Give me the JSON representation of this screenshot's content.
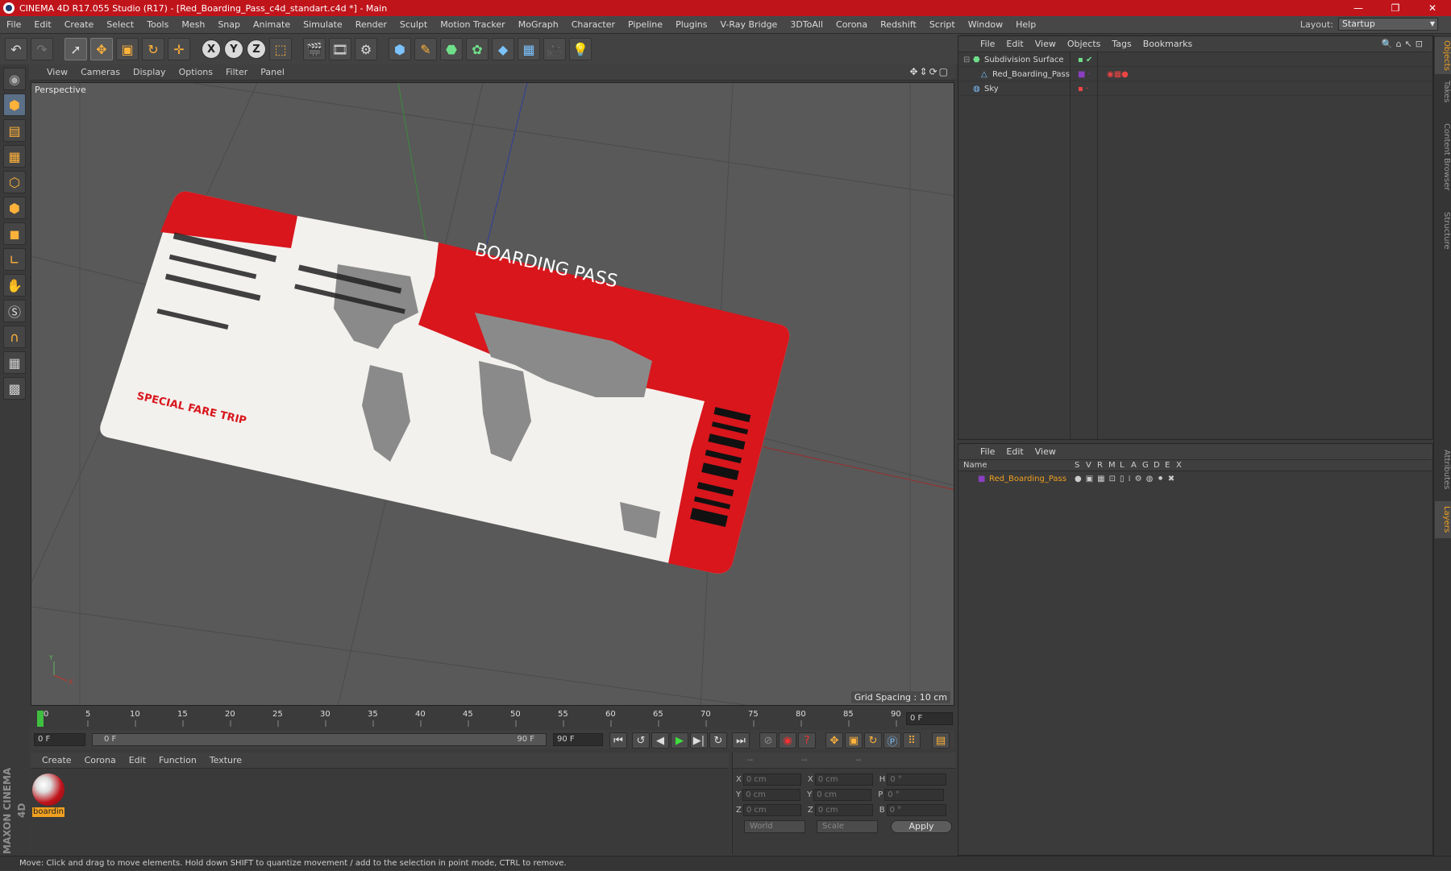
{
  "window": {
    "title": "CINEMA 4D R17.055 Studio (R17) - [Red_Boarding_Pass_c4d_standart.c4d *] - Main",
    "controls": [
      "—",
      "❐",
      "✕"
    ]
  },
  "menu": [
    "File",
    "Edit",
    "Create",
    "Select",
    "Tools",
    "Mesh",
    "Snap",
    "Animate",
    "Simulate",
    "Render",
    "Sculpt",
    "Motion Tracker",
    "MoGraph",
    "Character",
    "Pipeline",
    "Plugins",
    "V-Ray Bridge",
    "3DToAll",
    "Corona",
    "Redshift",
    "Script",
    "Window",
    "Help"
  ],
  "layout": {
    "label": "Layout:",
    "value": "Startup"
  },
  "viewport": {
    "menu": [
      "View",
      "Cameras",
      "Display",
      "Options",
      "Filter",
      "Panel"
    ],
    "label": "Perspective",
    "grid_spacing": "Grid Spacing : 10 cm",
    "axis_x": "X",
    "axis_y": "Y",
    "model_title": "BOARDING PASS",
    "model_tag": "SPECIAL FARE TRIP"
  },
  "timeline": {
    "ticks": [
      "0",
      "5",
      "10",
      "15",
      "20",
      "25",
      "30",
      "35",
      "40",
      "45",
      "50",
      "55",
      "60",
      "65",
      "70",
      "75",
      "80",
      "85",
      "90"
    ],
    "frame_field": "0 F"
  },
  "transport": {
    "start": "0 F",
    "range_start": "0 F",
    "range_end": "90 F",
    "end": "90 F"
  },
  "materials": {
    "menu": [
      "Create",
      "Corona",
      "Edit",
      "Function",
      "Texture"
    ],
    "item": "boardin"
  },
  "coords": {
    "headers": [
      "--",
      "--",
      "--"
    ],
    "rows": [
      {
        "a": "X",
        "av": "0 cm",
        "b": "X",
        "bv": "0 cm",
        "c": "H",
        "cv": "0 °"
      },
      {
        "a": "Y",
        "av": "0 cm",
        "b": "Y",
        "bv": "0 cm",
        "c": "P",
        "cv": "0 °"
      },
      {
        "a": "Z",
        "av": "0 cm",
        "b": "Z",
        "bv": "0 cm",
        "c": "B",
        "cv": "0 °"
      }
    ],
    "mode1": "World",
    "mode2": "Scale",
    "apply": "Apply"
  },
  "objects": {
    "menu": [
      "File",
      "Edit",
      "View",
      "Objects",
      "Tags",
      "Bookmarks"
    ],
    "items": [
      "Subdivision Surface",
      "Red_Boarding_Pass",
      "Sky"
    ]
  },
  "layers": {
    "menu": [
      "File",
      "Edit",
      "View"
    ],
    "columns": [
      "Name",
      "S",
      "V",
      "R",
      "M",
      "L",
      "A",
      "G",
      "D",
      "E",
      "X"
    ],
    "items": [
      "Red_Boarding_Pass"
    ]
  },
  "right_tabs": [
    "Objects",
    "Takes",
    "Content Browser",
    "Structure",
    "Attributes",
    "Layers"
  ],
  "brand": "MAXON CINEMA 4D",
  "status": "Move: Click and drag to move elements. Hold down SHIFT to quantize movement / add to the selection in point mode, CTRL to remove.",
  "colors": {
    "accent": "#c0141b",
    "highlight": "#f0a020",
    "viewport": "#595959"
  }
}
